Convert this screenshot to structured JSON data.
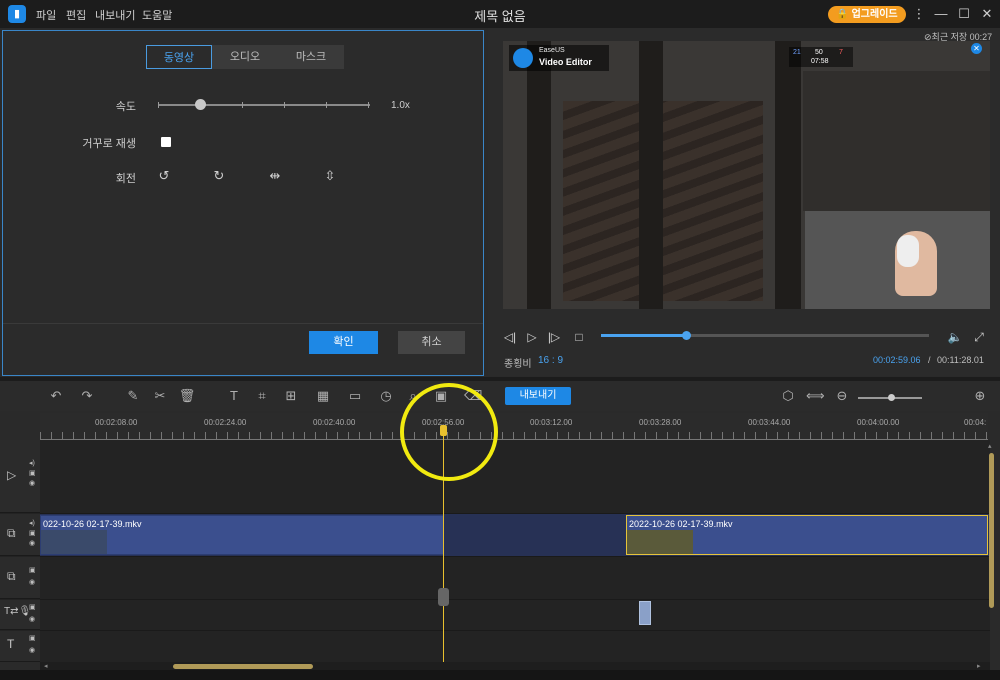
{
  "app": {
    "window_title": "제목 없음",
    "menu": [
      "파일",
      "편집",
      "내보내기",
      "도움말"
    ],
    "upgrade_label": "업그레이드"
  },
  "left_panel": {
    "tabs": [
      {
        "label": "동영상",
        "active": true
      },
      {
        "label": "오디오",
        "active": false
      },
      {
        "label": "마스크",
        "active": false
      }
    ],
    "speed_label": "속도",
    "speed_value": "1.0x",
    "speed_level": 0.2,
    "reverse_label": "거꾸로 재생",
    "rotate_label": "회전",
    "ok_label": "확인",
    "cancel_label": "취소"
  },
  "preview": {
    "last_saved": "최근 저장 00:27",
    "watermark_brand": "EaseUS",
    "watermark_product": "Video Editor",
    "hud": {
      "left": "21",
      "mid": "50",
      "right": "7",
      "time": "07:58"
    },
    "aspect_label": "종횡비",
    "aspect_value": "16 : 9",
    "current_time": "00:02:59.06",
    "time_separator": "/",
    "total_time": "00:11:28.01",
    "progress": 0.26
  },
  "toolbar": {
    "export_label": "내보내기"
  },
  "ruler": {
    "labels": [
      "00:02:08.00",
      "00:02:24.00",
      "00:02:40.00",
      "00:02:56.00",
      "00:03:12.00",
      "00:03:28.00",
      "00:03:44.00",
      "00:04:00.00",
      "00:04:"
    ]
  },
  "timeline": {
    "clips": [
      {
        "label": "022-10-26 02-17-39.mkv"
      },
      {
        "label": "2022-10-26 02-17-39.mkv"
      }
    ]
  },
  "colors": {
    "accent": "#1e88e5",
    "upgrade": "#f39c1f",
    "playhead": "#e8c02e",
    "highlight_circle": "#f1ea10",
    "clip": "#3b4f8e"
  }
}
